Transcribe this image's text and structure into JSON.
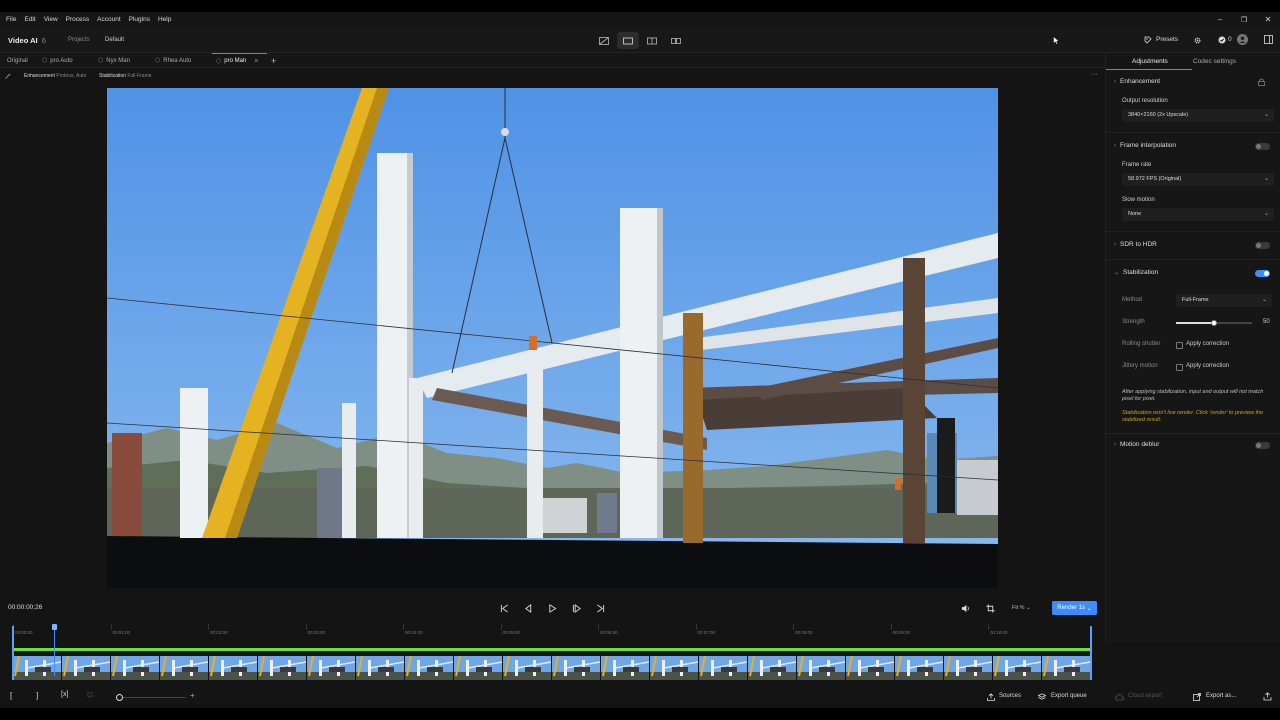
{
  "menu": [
    "File",
    "Edit",
    "View",
    "Process",
    "Account",
    "Plugins",
    "Help"
  ],
  "window_controls": {
    "minimize": "–",
    "maximize": "❐",
    "close": "✕"
  },
  "header": {
    "app_name": "Video AI",
    "app_version": "6",
    "breadcrumb_projects": "Projects",
    "breadcrumb_current": "Default",
    "presets_label": "Presets",
    "credits_count": "0"
  },
  "tabs": [
    {
      "label": "Original",
      "icon": ""
    },
    {
      "label": "pro Auto",
      "icon": "preset-icon"
    },
    {
      "label": "Nyx Man",
      "icon": "preset-icon"
    },
    {
      "label": "Rhea Auto",
      "icon": "preset-icon"
    },
    {
      "label": "pro Man",
      "icon": "preset-icon",
      "active": true
    }
  ],
  "add_tab_symbol": "+",
  "subbar": {
    "enhancement_label": "Enhancement",
    "enhancement_value": "Proteus, Auto",
    "stabilization_label": "Stabilization",
    "stabilization_value": "Full-Frame",
    "more_symbol": "···"
  },
  "panel": {
    "tab_adjustments": "Adjustments",
    "tab_codec": "Codec settings",
    "enhancement": {
      "title": "Enhancement"
    },
    "output_resolution": {
      "label": "Output resolution",
      "value": "3840×2160 (2x Upscale)"
    },
    "frame_interpolation": {
      "title": "Frame interpolation",
      "enabled": false
    },
    "frame_rate": {
      "label": "Frame rate",
      "value": "58.972 FPS (Original)"
    },
    "slow_motion": {
      "label": "Slow motion",
      "value": "None"
    },
    "sdr_to_hdr": {
      "title": "SDR to HDR",
      "enabled": false
    },
    "stabilization": {
      "title": "Stabilization",
      "enabled": true,
      "method_label": "Method",
      "method_value": "Full-Frame",
      "strength_label": "Strength",
      "strength_value": "50",
      "strength_fraction": 0.5,
      "rolling_label": "Rolling shutter",
      "rolling_check": "Apply correction",
      "jittery_label": "Jittery motion",
      "jittery_check": "Apply correction",
      "note": "After applying stabilization, input and output will not match pixel for pixel.",
      "warning": "Stabilization won't live render. Click 'render' to preview the stabilized result.",
      "warning_color": "#c9a227"
    },
    "motion_deblur": {
      "title": "Motion deblur",
      "enabled": false
    }
  },
  "transport": {
    "timecode": "00:00:00;26",
    "zoom": "Fit %",
    "render_label": "Render 1s"
  },
  "timeline": {
    "ticks": [
      "00:00:00",
      "00:01:00",
      "00:02:00",
      "00:03:00",
      "00:04:00",
      "00:05:00",
      "00:06:00",
      "00:07:00",
      "00:08:00",
      "00:09:00",
      "00:10:00"
    ],
    "progress_color": "#6ee22f"
  },
  "bottom": {
    "sources_label": "Sources",
    "export_queue_label": "Export queue",
    "cloud_export_label": "Cloud export",
    "export_as_label": "Export as..."
  },
  "accent": "#3d8bff"
}
